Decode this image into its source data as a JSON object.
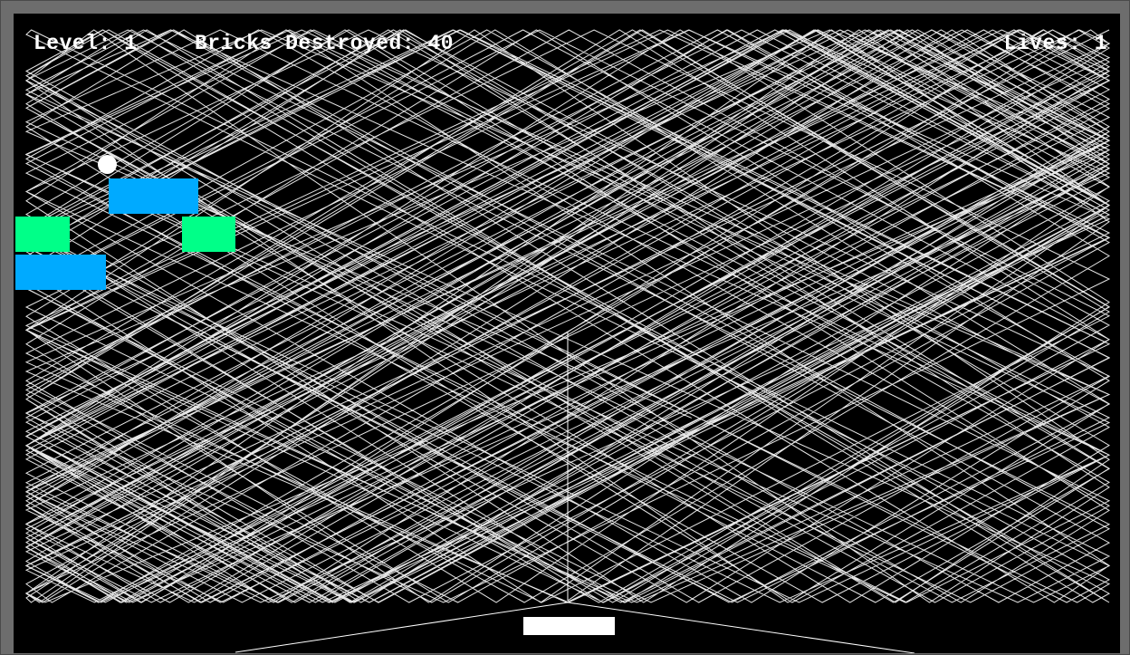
{
  "hud": {
    "level_text": "Level: 1",
    "bricks_text": "Bricks Destroyed: 40",
    "lives_text": "Lives: 1"
  },
  "game": {
    "level": 1,
    "bricks_destroyed": 40,
    "lives": 1
  },
  "bricks": [
    {
      "color": "#00aaff",
      "kind": "blue"
    },
    {
      "color": "#00ff88",
      "kind": "green"
    },
    {
      "color": "#00ff88",
      "kind": "green"
    },
    {
      "color": "#00aaff",
      "kind": "blue"
    }
  ],
  "colors": {
    "background": "#000000",
    "frame": "#6d6d6d",
    "trail": "#ffffff",
    "ball": "#ffffff",
    "paddle": "#ffffff",
    "text": "#ffffff"
  }
}
